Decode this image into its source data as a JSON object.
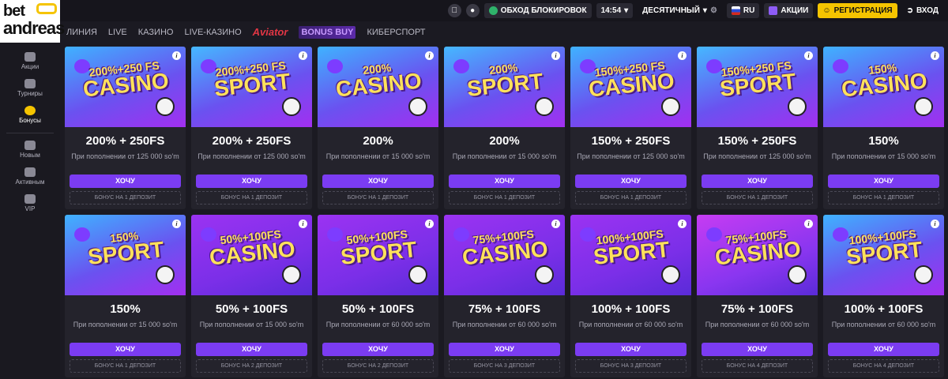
{
  "brand": {
    "line1": "bet",
    "line2": "andreas"
  },
  "nav": {
    "items": [
      "ЛИНИЯ",
      "LIVE",
      "КАЗИНО",
      "LIVE-КАЗИНО"
    ],
    "aviator": "Aviator",
    "bonus_buy": "BONUS BUY",
    "esports": "КИБЕРСПОРТ"
  },
  "header": {
    "bypass": "ОБХОД БЛОКИРОВОК",
    "time": "14:54",
    "odds_format": "ДЕСЯТИЧНЫЙ",
    "lang": "RU",
    "promos": "АКЦИИ",
    "register": "РЕГИСТРАЦИЯ",
    "login": "ВХОД"
  },
  "sidebar": {
    "items": [
      {
        "label": "Акции",
        "icon": "gift-icon"
      },
      {
        "label": "Турниры",
        "icon": "trophy-icon"
      },
      {
        "label": "Бонусы",
        "icon": "bonus-icon",
        "active": true
      },
      {
        "label": "Новым",
        "icon": "newbie-icon"
      },
      {
        "label": "Активным",
        "icon": "hand-icon"
      },
      {
        "label": "VIP",
        "icon": "crown-icon"
      }
    ]
  },
  "cards": [
    {
      "banner_top": "200%+250 FS",
      "banner_main": "CASINO",
      "title": "200% + 250FS",
      "desc": "При пополнении от 125 000 so'm",
      "button": "ХОЧУ",
      "deposit": "БОНУС НА 1 ДЕПОЗИТ"
    },
    {
      "banner_top": "200%+250 FS",
      "banner_main": "SPORT",
      "title": "200% + 250FS",
      "desc": "При пополнении от 125 000 so'm",
      "button": "ХОЧУ",
      "deposit": "БОНУС НА 1 ДЕПОЗИТ"
    },
    {
      "banner_top": "200%",
      "banner_main": "CASINO",
      "title": "200%",
      "desc": "При пополнении от 15 000 so'm",
      "button": "ХОЧУ",
      "deposit": "БОНУС НА 1 ДЕПОЗИТ"
    },
    {
      "banner_top": "200%",
      "banner_main": "SPORT",
      "title": "200%",
      "desc": "При пополнении от 15 000 so'm",
      "button": "ХОЧУ",
      "deposit": "БОНУС НА 1 ДЕПОЗИТ"
    },
    {
      "banner_top": "150%+250 FS",
      "banner_main": "CASINO",
      "title": "150% + 250FS",
      "desc": "При пополнении от 125 000 so'm",
      "button": "ХОЧУ",
      "deposit": "БОНУС НА 1 ДЕПОЗИТ"
    },
    {
      "banner_top": "150%+250 FS",
      "banner_main": "SPORT",
      "title": "150% + 250FS",
      "desc": "При пополнении от 125 000 so'm",
      "button": "ХОЧУ",
      "deposit": "БОНУС НА 1 ДЕПОЗИТ"
    },
    {
      "banner_top": "150%",
      "banner_main": "CASINO",
      "title": "150%",
      "desc": "При пополнении от 15 000 so'm",
      "button": "ХОЧУ",
      "deposit": "БОНУС НА 1 ДЕПОЗИТ"
    },
    {
      "banner_top": "150%",
      "banner_main": "SPORT",
      "title": "150%",
      "desc": "При пополнении от 15 000 so'm",
      "button": "ХОЧУ",
      "deposit": "БОНУС НА 1 ДЕПОЗИТ"
    },
    {
      "banner_top": "50%+100FS",
      "banner_main": "CASINO",
      "title": "50% + 100FS",
      "desc": "При пополнении от 15 000 so'm",
      "button": "ХОЧУ",
      "deposit": "БОНУС НА 2 ДЕПОЗИТ"
    },
    {
      "banner_top": "50%+100FS",
      "banner_main": "SPORT",
      "title": "50% + 100FS",
      "desc": "При пополнении от 60 000 so'm",
      "button": "ХОЧУ",
      "deposit": "БОНУС НА 2 ДЕПОЗИТ"
    },
    {
      "banner_top": "75%+100FS",
      "banner_main": "CASINO",
      "title": "75% + 100FS",
      "desc": "При пополнении от 60 000 so'm",
      "button": "ХОЧУ",
      "deposit": "БОНУС НА 3 ДЕПОЗИТ"
    },
    {
      "banner_top": "100%+100FS",
      "banner_main": "SPORT",
      "title": "100% + 100FS",
      "desc": "При пополнении от 60 000 so'm",
      "button": "ХОЧУ",
      "deposit": "БОНУС НА 3 ДЕПОЗИТ"
    },
    {
      "banner_top": "75%+100FS",
      "banner_main": "CASINO",
      "title": "75% + 100FS",
      "desc": "При пополнении от 60 000 so'm",
      "button": "ХОЧУ",
      "deposit": "БОНУС НА 4 ДЕПОЗИТ"
    },
    {
      "banner_top": "100%+100FS",
      "banner_main": "SPORT",
      "title": "100% + 100FS",
      "desc": "При пополнении от 60 000 so'm",
      "button": "ХОЧУ",
      "deposit": "БОНУС НА 4 ДЕПОЗИТ"
    }
  ],
  "colors": {
    "accent_purple": "#7b3cf2",
    "brand_yellow": "#f5c400",
    "background": "#1b1a22",
    "card": "#24232c"
  }
}
